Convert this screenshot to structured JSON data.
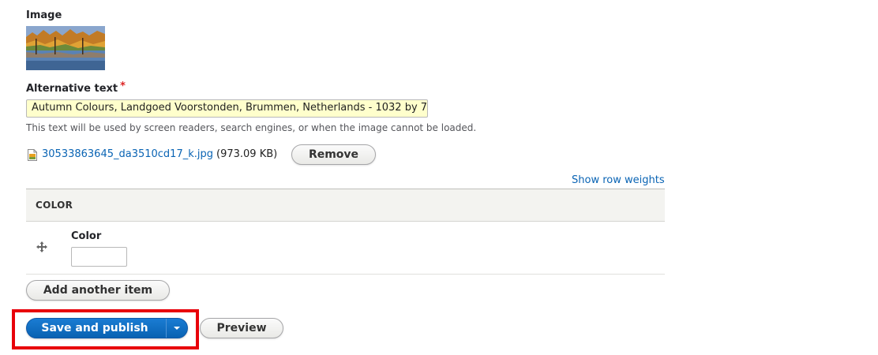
{
  "image_field": {
    "label": "Image",
    "alt_label": "Alternative text",
    "required_mark": "*",
    "alt_value": "Autumn Colours, Landgoed Voorstonden, Brummen, Netherlands - 1032 by 7",
    "alt_description": "This text will be used by screen readers, search engines, or when the image cannot be loaded.",
    "file_name": "30533863645_da3510cd17_k.jpg",
    "file_size": "(973.09 KB)",
    "remove_label": "Remove"
  },
  "table": {
    "row_weights_link": "Show row weights",
    "header": "COLOR",
    "row": {
      "field_label": "Color",
      "value": ""
    },
    "add_item_label": "Add another item"
  },
  "actions": {
    "save_label": "Save and publish",
    "preview_label": "Preview"
  },
  "colors": {
    "primary": "#0962b2",
    "link": "#0a64b4",
    "required": "#dc2323",
    "highlight": "#e8000a",
    "input_highlight": "#ffffcc"
  }
}
